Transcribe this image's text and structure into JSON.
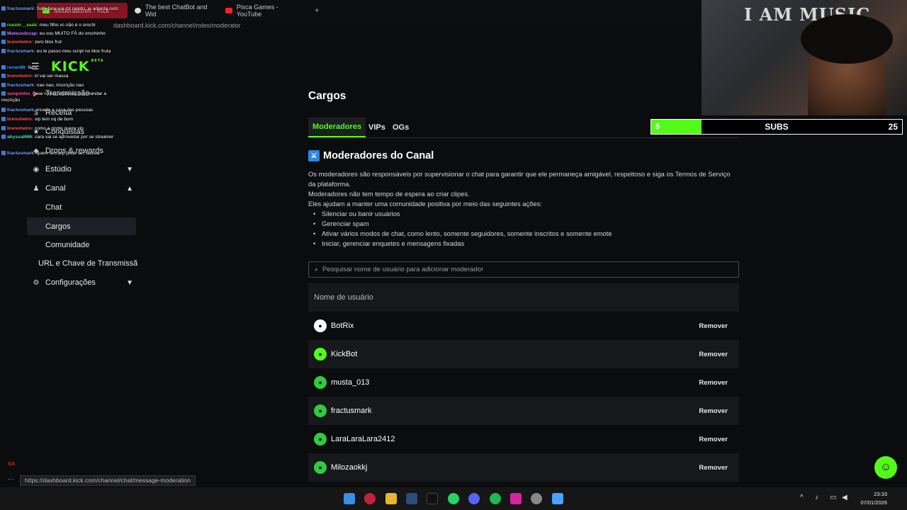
{
  "browser": {
    "tabs": [
      {
        "label": "Moderadores - Kick"
      },
      {
        "label": "The best ChatBot and Wid"
      },
      {
        "label": "Pisca Games - YouTube"
      }
    ],
    "new_tab": "+",
    "url": "dashboard.kick.com/channel/roles/moderator",
    "status_url": "https://dashboard.kick.com/channel/chat/message-moderation"
  },
  "sidebar": {
    "logo": "KICK",
    "logo_badge": "BETA",
    "items": [
      {
        "label": "Transmissão",
        "icon": "video-icon"
      },
      {
        "label": "Receita",
        "icon": "dollar-icon"
      },
      {
        "label": "Conquistas",
        "icon": "trophy-icon"
      },
      {
        "label": "Drops & rewards",
        "icon": "gift-icon"
      },
      {
        "label": "Estúdio",
        "icon": "studio-icon"
      },
      {
        "label": "Canal",
        "icon": "users-icon"
      }
    ],
    "canal_sub": [
      "Chat",
      "Cargos",
      "Comunidade"
    ],
    "stream_key": "URL e Chave de Transmissã",
    "settings": "Configurações"
  },
  "chat": [
    {
      "user": "fractusmark:",
      "color": "#6ea8ff",
      "text": "Sally fase vai mt rapido, ja adianta outri"
    },
    {
      "user": "russin__xask:",
      "color": "#53fc18",
      "text": "meu filho vc não é o orochi"
    },
    {
      "user": "Mateusdozap:",
      "color": "#c77dff",
      "text": "eu sou MUITO FÃ do orochinho"
    },
    {
      "user": "brenohetro:",
      "color": "#ff5a5a",
      "text": "zero blox frut"
    },
    {
      "user": "fractusmark:",
      "color": "#6ea8ff",
      "text": "eu te passo meu script no blox fruta"
    },
    {
      "user": "renan88:",
      "color": "#3aa0ff",
      "text": "farm"
    },
    {
      "user": "brenohetro:",
      "color": "#ff5a5a",
      "text": "irl vai ser massa"
    },
    {
      "user": "fractusmark:",
      "color": "#6ea8ff",
      "text": "nao nao, inscrição nao"
    },
    {
      "user": "surquinho_0:",
      "color": "#ff5a8a",
      "text": "se n tiver verba eu vou mandar a inscrição"
    },
    {
      "user": "fractusmark:",
      "color": "#6ea8ff",
      "text": "invade a casa das pessoas"
    },
    {
      "user": "brenohetro:",
      "color": "#ff5a5a",
      "text": "vip tem oq de bom"
    },
    {
      "user": "brenohetro:",
      "color": "#ff5a5a",
      "text": "como a gnnte quere vip"
    },
    {
      "user": "abyssal666:",
      "color": "#4be0c8",
      "text": "cara vai se aproveitar por se streamer"
    },
    {
      "user": "fractusmark:",
      "color": "#6ea8ff",
      "text": "quem tem vip pode ser racista"
    }
  ],
  "main": {
    "title": "Cargos",
    "tabs": [
      "Moderadores",
      "VIPs",
      "OGs"
    ],
    "section_title": "Moderadores do Canal",
    "desc_lines": [
      "Os moderadores são responsáveis por supervisionar o chat para garantir que ele permaneça amigável, respeitoso e siga os Termos de Serviço da plataforma.",
      "Moderadores não tem tempo de espera ao criar clipes.",
      "Eles ajudam a manter uma comunidade positiva por meio das seguintes ações:"
    ],
    "actions": [
      "Silenciar ou banir usuários",
      "Gerenciar spam",
      "Ativar vários modos de chat, como lento, somente seguidores, somente inscritos e somente emote",
      "Iniciar, gerenciar enquetes e mensagens fixadas"
    ],
    "search_placeholder": "Pesquisar nome de usuário para adicionar moderador",
    "column_header": "Nome de usuário",
    "remove_label": "Remover",
    "moderators": [
      {
        "name": "BotRix",
        "avatar_color": "#ffffff"
      },
      {
        "name": "KickBot",
        "avatar_color": "#53fc18"
      },
      {
        "name": "musta_013",
        "avatar_color": "#2ecc40"
      },
      {
        "name": "fractusmark",
        "avatar_color": "#2ecc40"
      },
      {
        "name": "LaraLaraLara2412",
        "avatar_color": "#2ecc40"
      },
      {
        "name": "Milozaokkj",
        "avatar_color": "#2ecc40"
      }
    ]
  },
  "overlay": {
    "webcam_wall_text": "I AM MUSIC",
    "subs_current": "5",
    "subs_label": "SUBS",
    "subs_goal": "25",
    "subs_progress": 0.2,
    "gx_label": "GX"
  },
  "taskbar": {
    "time": "23:33",
    "date": "07/01/2026"
  },
  "colors": {
    "accent": "#53fc18",
    "background": "#0b0c0e",
    "row_alt": "#17181b"
  }
}
